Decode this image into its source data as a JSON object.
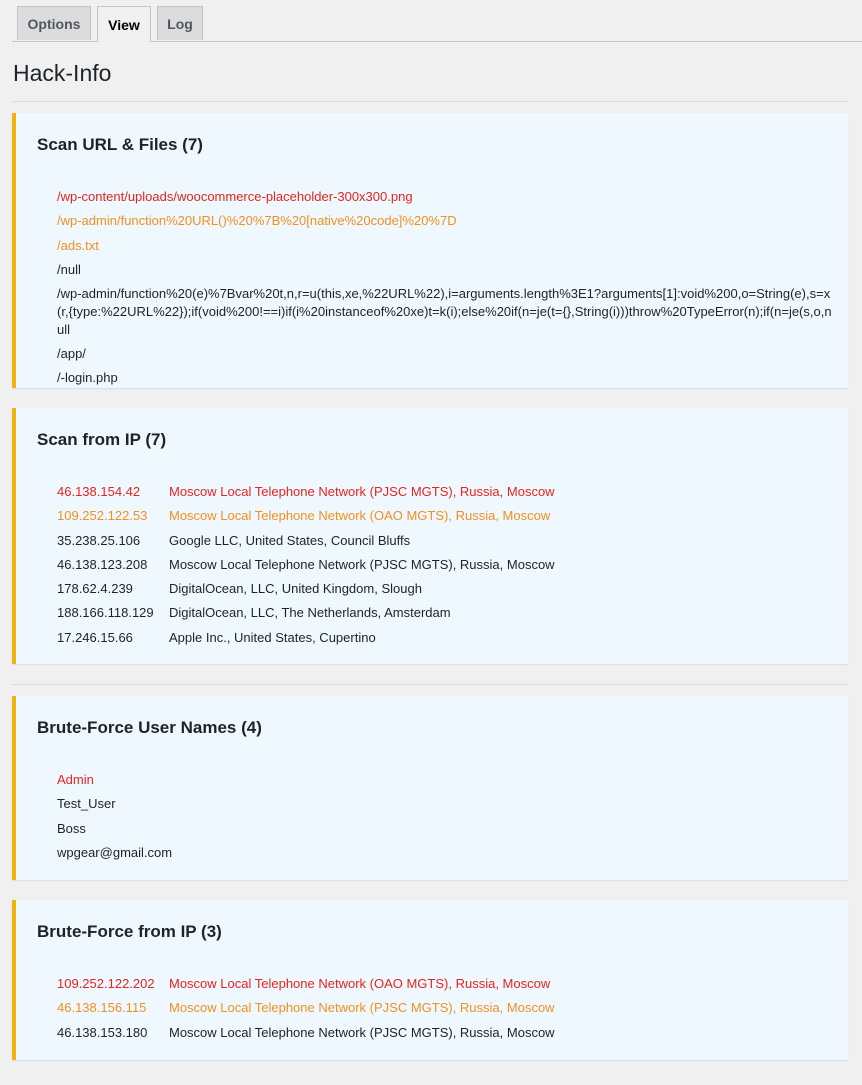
{
  "tabs": [
    {
      "label": "Options",
      "active": false
    },
    {
      "label": "View",
      "active": true
    },
    {
      "label": "Log",
      "active": false
    }
  ],
  "page_title": "Hack-Info",
  "colors": {
    "danger": "#e3251d",
    "warning": "#f0901e",
    "accent_border": "#f0b40e",
    "panel_bg": "#f0f8ff"
  },
  "scan_files": {
    "title": "Scan URL & Files (7)",
    "items": [
      {
        "text": "/wp-content/uploads/woocommerce-placeholder-300x300.png",
        "level": "red"
      },
      {
        "text": "/wp-admin/function%20URL()%20%7B%20[native%20code]%20%7D",
        "level": "orange"
      },
      {
        "text": "/ads.txt",
        "level": "orange"
      },
      {
        "text": "/null",
        "level": "normal"
      },
      {
        "text": "/wp-admin/function%20(e)%7Bvar%20t,n,r=u(this,xe,%22URL%22),i=arguments.length%3E1?arguments[1]:void%200,o=String(e),s=x(r,{type:%22URL%22});if(void%200!==i)if(i%20instanceof%20xe)t=k(i);else%20if(n=je(t={},String(i)))throw%20TypeError(n);if(n=je(s,o,null",
        "level": "normal"
      },
      {
        "text": "/app/",
        "level": "normal"
      },
      {
        "text": "/-login.php",
        "level": "normal"
      }
    ]
  },
  "scan_ip": {
    "title": "Scan from IP (7)",
    "items": [
      {
        "ip": "46.138.154.42",
        "info": "Moscow Local Telephone Network (PJSC MGTS), Russia, Moscow",
        "level": "red"
      },
      {
        "ip": "109.252.122.53",
        "info": "Moscow Local Telephone Network (OAO MGTS), Russia, Moscow",
        "level": "orange"
      },
      {
        "ip": "35.238.25.106",
        "info": "Google LLC, United States, Council Bluffs",
        "level": "normal"
      },
      {
        "ip": "46.138.123.208",
        "info": "Moscow Local Telephone Network (PJSC MGTS), Russia, Moscow",
        "level": "normal"
      },
      {
        "ip": "178.62.4.239",
        "info": "DigitalOcean, LLC, United Kingdom, Slough",
        "level": "normal"
      },
      {
        "ip": "188.166.118.129",
        "info": "DigitalOcean, LLC, The Netherlands, Amsterdam",
        "level": "normal"
      },
      {
        "ip": "17.246.15.66",
        "info": "Apple Inc., United States, Cupertino",
        "level": "normal"
      }
    ]
  },
  "brute_users": {
    "title": "Brute-Force User Names (4)",
    "items": [
      {
        "text": "Admin",
        "level": "red"
      },
      {
        "text": "Test_User",
        "level": "normal"
      },
      {
        "text": "Boss",
        "level": "normal"
      },
      {
        "text": "wpgear@gmail.com",
        "level": "normal"
      }
    ]
  },
  "brute_ip": {
    "title": "Brute-Force from IP (3)",
    "items": [
      {
        "ip": "109.252.122.202",
        "info": "Moscow Local Telephone Network (OAO MGTS), Russia, Moscow",
        "level": "red"
      },
      {
        "ip": "46.138.156.115",
        "info": "Moscow Local Telephone Network (PJSC MGTS), Russia, Moscow",
        "level": "orange"
      },
      {
        "ip": "46.138.153.180",
        "info": "Moscow Local Telephone Network (PJSC MGTS), Russia, Moscow",
        "level": "normal"
      }
    ]
  }
}
